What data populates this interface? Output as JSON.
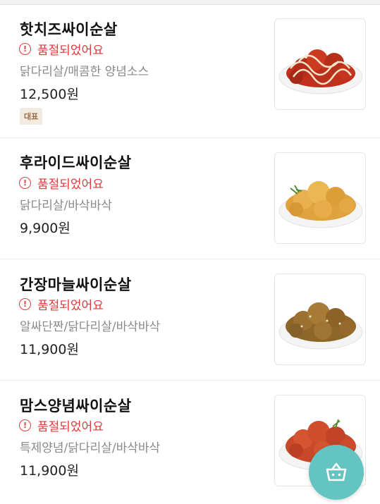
{
  "menu": {
    "items": [
      {
        "name": "핫치즈싸이순살",
        "status": "품절되었어요",
        "description": "닭다리살/매콤한 양념소스",
        "price": "12,500원",
        "badge": "대표",
        "image": "spicy-cheese-chicken"
      },
      {
        "name": "후라이드싸이순살",
        "status": "품절되었어요",
        "description": "닭다리살/바삭바삭",
        "price": "9,900원",
        "image": "fried-chicken"
      },
      {
        "name": "간장마늘싸이순살",
        "status": "품절되었어요",
        "description": "알싸단짠/닭다리살/바삭바삭",
        "price": "11,900원",
        "image": "soy-garlic-chicken"
      },
      {
        "name": "맘스양념싸이순살",
        "status": "품절되었어요",
        "description": "특제양념/닭다리살/바삭바삭",
        "price": "11,900원",
        "image": "seasoned-chicken"
      }
    ]
  },
  "icons": {
    "warning": "exclamation-circle-icon",
    "cart": "shopping-basket-icon"
  },
  "colors": {
    "sold_out": "#e1393d",
    "accent": "#63c4c2",
    "badge_bg": "#f3ebe2",
    "badge_text": "#9b6b45"
  }
}
